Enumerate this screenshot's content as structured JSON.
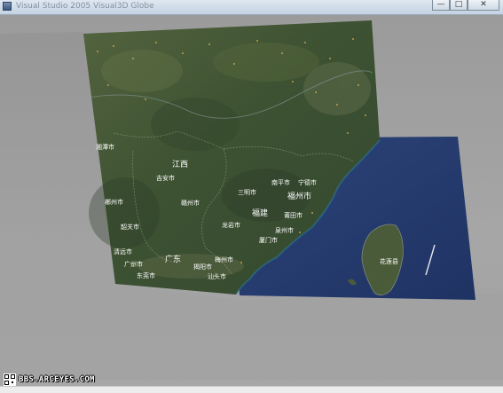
{
  "window": {
    "title": "Visual Studio 2005 Visual3D Globe",
    "caption_buttons": {
      "minimize": "—",
      "restore": "□",
      "close": "✕"
    }
  },
  "map": {
    "labels": {
      "jiangxi": "江西",
      "jian": "吉安市",
      "ganzhou": "赣州市",
      "nanping": "南平市",
      "ningde": "宁德市",
      "sanming": "三明市",
      "fuzhou": "福州市",
      "fujian": "福建",
      "putian": "莆田市",
      "longyan": "龙岩市",
      "quanzhou": "泉州市",
      "xiamen": "厦门市",
      "guangdong": "广东",
      "meizhou": "梅州市",
      "jieyang": "揭阳市",
      "shantou": "汕头市",
      "shaoguan": "韶关市",
      "qingyuan": "清远市",
      "guangzhou": "广州市",
      "dongguan": "东莞市",
      "hualien": "花莲县",
      "xiangtan": "湘潭市",
      "chenzhou": "郴州市"
    }
  },
  "watermark": {
    "text": "BBS.ARCEYES.COM"
  },
  "colors": {
    "background": "#a7a7a7",
    "land": "#3d5133",
    "sea": "#273d6e"
  }
}
